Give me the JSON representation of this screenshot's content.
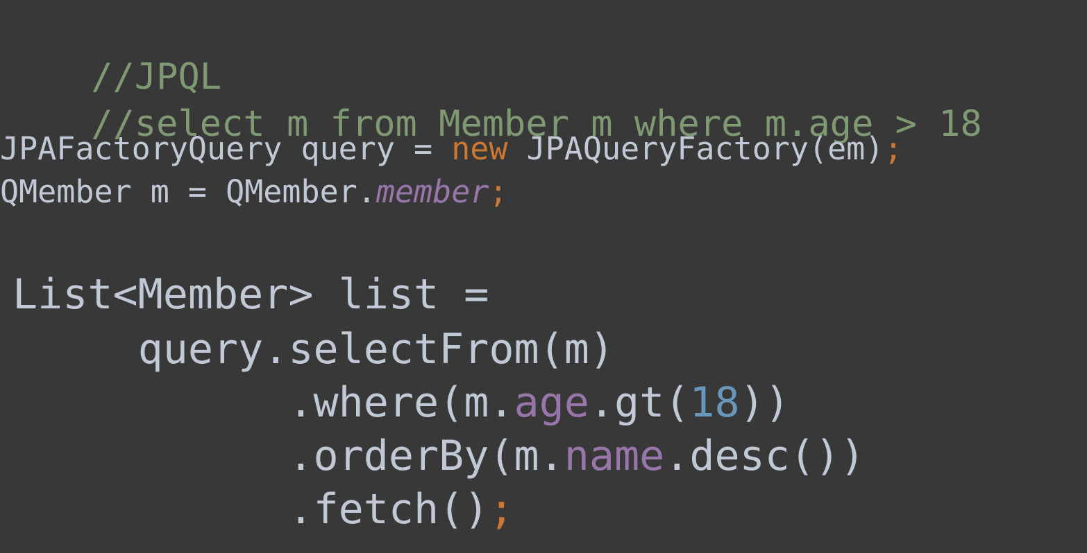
{
  "editor": {
    "lines": [
      {
        "id": "comment-jpql",
        "tokens": [
          {
            "text": "//JPQL",
            "kind": "comment"
          }
        ]
      },
      {
        "id": "comment-select",
        "tokens": [
          {
            "text": "//select m from Member m where m.age > 18",
            "kind": "comment"
          }
        ]
      },
      {
        "id": "query-factory-decl",
        "tokens": [
          {
            "text": "JPAFactoryQuery query = ",
            "kind": "plain"
          },
          {
            "text": "new",
            "kind": "keyword"
          },
          {
            "text": " JPAQueryFactory(em)",
            "kind": "plain"
          },
          {
            "text": ";",
            "kind": "semi"
          }
        ]
      },
      {
        "id": "qmember-decl",
        "tokens": [
          {
            "text": "QMember m = QMember.",
            "kind": "plain"
          },
          {
            "text": "member",
            "kind": "static-field"
          },
          {
            "text": ";",
            "kind": "semi"
          }
        ]
      },
      {
        "id": "list-decl",
        "tokens": [
          {
            "text": "List<Member> list =",
            "kind": "plain"
          }
        ]
      },
      {
        "id": "select-from-call",
        "tokens": [
          {
            "text": "     query.selectFrom(m)",
            "kind": "plain"
          }
        ]
      },
      {
        "id": "where-call",
        "tokens": [
          {
            "text": "           .where(m.",
            "kind": "plain"
          },
          {
            "text": "age",
            "kind": "field"
          },
          {
            "text": ".gt(",
            "kind": "plain"
          },
          {
            "text": "18",
            "kind": "number"
          },
          {
            "text": "))",
            "kind": "plain"
          }
        ]
      },
      {
        "id": "order-by-call",
        "tokens": [
          {
            "text": "           .orderBy(m.",
            "kind": "plain"
          },
          {
            "text": "name",
            "kind": "field"
          },
          {
            "text": ".desc())",
            "kind": "plain"
          }
        ]
      },
      {
        "id": "fetch-call",
        "tokens": [
          {
            "text": "           .fetch()",
            "kind": "plain"
          },
          {
            "text": ";",
            "kind": "semi"
          }
        ]
      }
    ]
  },
  "colors": {
    "background": "#383838",
    "plain": "#c2c9d6",
    "comment": "#7f9a72",
    "keyword": "#cc7832",
    "field": "#9876aa",
    "number": "#6897bb"
  }
}
